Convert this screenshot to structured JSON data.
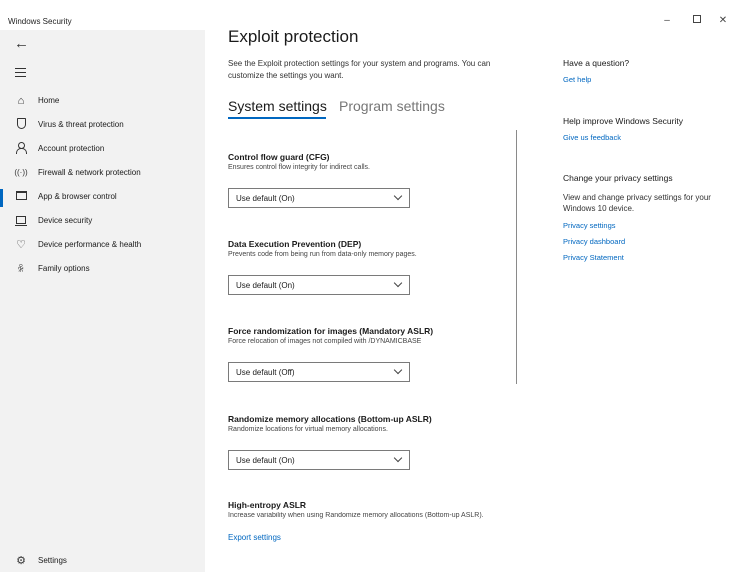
{
  "window": {
    "title": "Windows Security",
    "controls": {
      "minimize": "–",
      "close": "✕"
    }
  },
  "sidebar": {
    "items": [
      {
        "label": "Home",
        "icon": "home-icon"
      },
      {
        "label": "Virus & threat protection",
        "icon": "shield-icon"
      },
      {
        "label": "Account protection",
        "icon": "person-icon"
      },
      {
        "label": "Firewall & network protection",
        "icon": "wifi-icon"
      },
      {
        "label": "App & browser control",
        "icon": "browser-icon",
        "active": true
      },
      {
        "label": "Device security",
        "icon": "device-icon"
      },
      {
        "label": "Device performance & health",
        "icon": "heart-icon"
      },
      {
        "label": "Family options",
        "icon": "family-icon"
      }
    ],
    "settings_label": "Settings"
  },
  "main": {
    "title": "Exploit protection",
    "description": "See the Exploit protection settings for your system and programs.  You can customize the settings you want.",
    "tabs": [
      {
        "label": "System settings",
        "active": true
      },
      {
        "label": "Program settings",
        "active": false
      }
    ],
    "settings": [
      {
        "title": "Control flow guard (CFG)",
        "description": "Ensures control flow integrity for indirect calls.",
        "value": "Use default (On)"
      },
      {
        "title": "Data Execution Prevention (DEP)",
        "description": "Prevents code from being run from data-only memory pages.",
        "value": "Use default (On)"
      },
      {
        "title": "Force randomization for images (Mandatory ASLR)",
        "description": "Force relocation of images not compiled with /DYNAMICBASE",
        "value": "Use default (Off)"
      },
      {
        "title": "Randomize memory allocations (Bottom-up ASLR)",
        "description": "Randomize locations for virtual memory allocations.",
        "value": "Use default (On)"
      }
    ],
    "high_entropy": {
      "title": "High-entropy ASLR",
      "description": "Increase variability when using Randomize memory allocations (Bottom-up ASLR)."
    },
    "export_label": "Export settings"
  },
  "side_panel": {
    "question_heading": "Have a question?",
    "get_help": "Get help",
    "improve_heading": "Help improve Windows Security",
    "feedback": "Give us feedback",
    "privacy_heading": "Change your privacy settings",
    "privacy_text": "View and change privacy settings for your Windows 10 device.",
    "privacy_settings": "Privacy settings",
    "privacy_dashboard": "Privacy dashboard",
    "privacy_statement": "Privacy Statement"
  },
  "colors": {
    "accent": "#0067c0",
    "sidebar_bg": "#f2f2f2",
    "main_bg": "#ffffff"
  }
}
